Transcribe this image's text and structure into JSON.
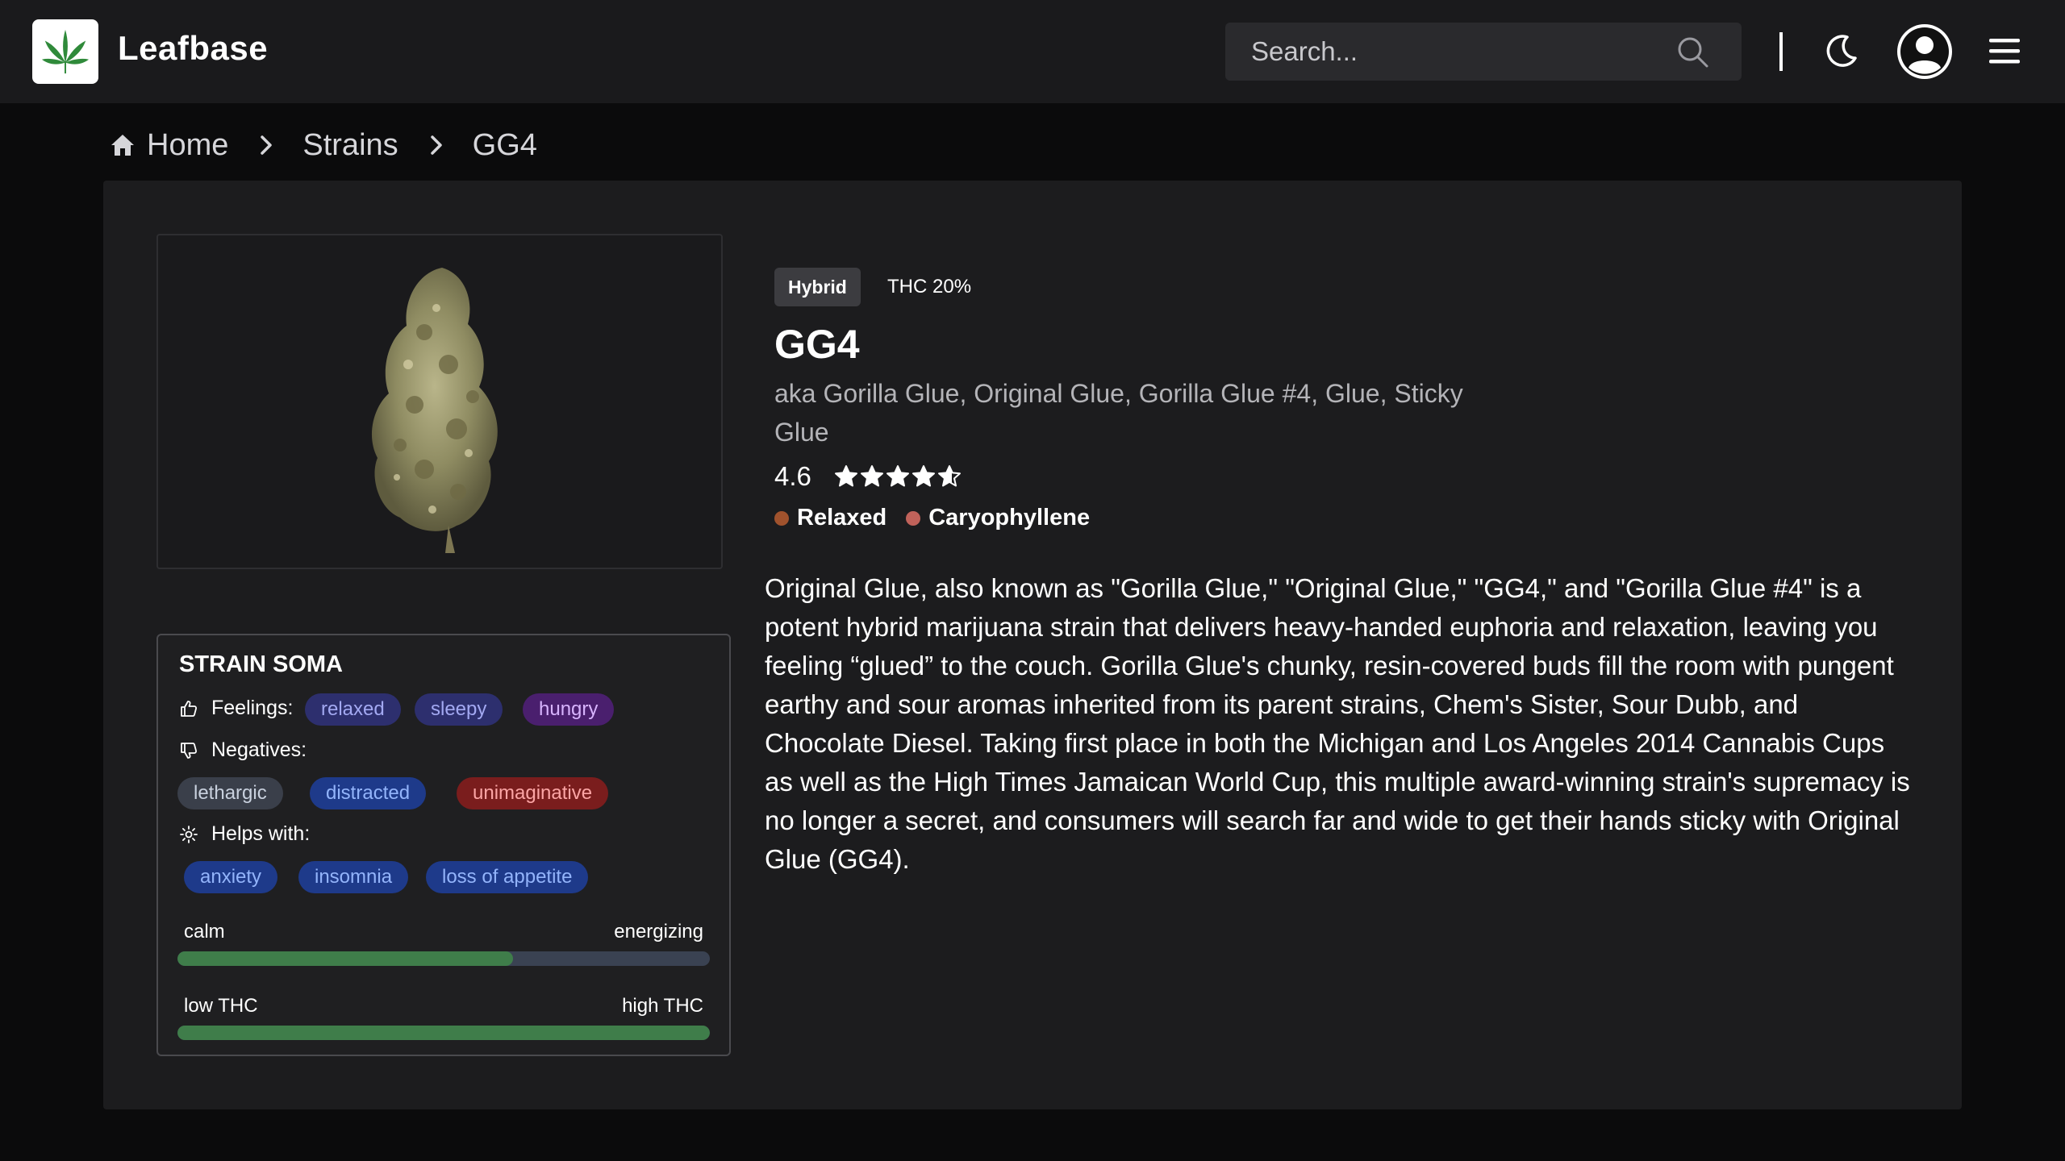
{
  "app": {
    "name": "Leafbase"
  },
  "search": {
    "placeholder": "Search..."
  },
  "breadcrumb": {
    "home": "Home",
    "strains": "Strains",
    "current": "GG4"
  },
  "strain": {
    "type": "Hybrid",
    "thc": "THC 20%",
    "name": "GG4",
    "aka": "aka Gorilla Glue, Original Glue, Gorilla Glue #4, Glue, Sticky Glue",
    "rating": "4.6",
    "rating_value": 4.6,
    "tags": [
      {
        "label": "Relaxed",
        "color": "#a0522d"
      },
      {
        "label": "Caryophyllene",
        "color": "#c0625a"
      }
    ],
    "description": "Original Glue, also known as \"Gorilla Glue,\" \"Original Glue,\" \"GG4,\" and \"Gorilla Glue #4\" is a potent hybrid marijuana strain that delivers heavy-handed euphoria and relaxation, leaving you feeling “glued” to the couch. Gorilla Glue's chunky, resin-covered buds fill the room with pungent earthy and sour aromas inherited from its parent strains, Chem's Sister, Sour Dubb, and Chocolate Diesel. Taking first place in both the Michigan and Los Angeles 2014 Cannabis Cups as well as the High Times Jamaican World Cup, this multiple award-winning strain's supremacy is no longer a secret, and consumers will search far and wide to get their hands sticky with Original Glue (GG4)."
  },
  "soma": {
    "title": "STRAIN SOMA",
    "feelings_label": "Feelings:",
    "feelings": [
      "relaxed",
      "sleepy",
      "hungry"
    ],
    "negatives_label": "Negatives:",
    "negatives": [
      "lethargic",
      "distracted",
      "unimaginative"
    ],
    "helps_label": "Helps with:",
    "helps": [
      "anxiety",
      "insomnia",
      "loss of appetite"
    ],
    "scale1": {
      "left": "calm",
      "right": "energizing",
      "value_percent": 63
    },
    "scale2": {
      "left": "low THC",
      "right": "high THC",
      "value_percent": 100
    }
  },
  "colors": {
    "accent_green": "#3f7d4a",
    "topbar": "#1a1a1c",
    "card": "#1c1c1e"
  },
  "icons": [
    "cannabis-leaf-logo",
    "search-icon",
    "moon-icon",
    "user-avatar-icon",
    "menu-icon",
    "home-icon",
    "chevron-right-icon",
    "star-icon",
    "thumbs-up-icon",
    "thumbs-down-icon",
    "gear-icon"
  ]
}
